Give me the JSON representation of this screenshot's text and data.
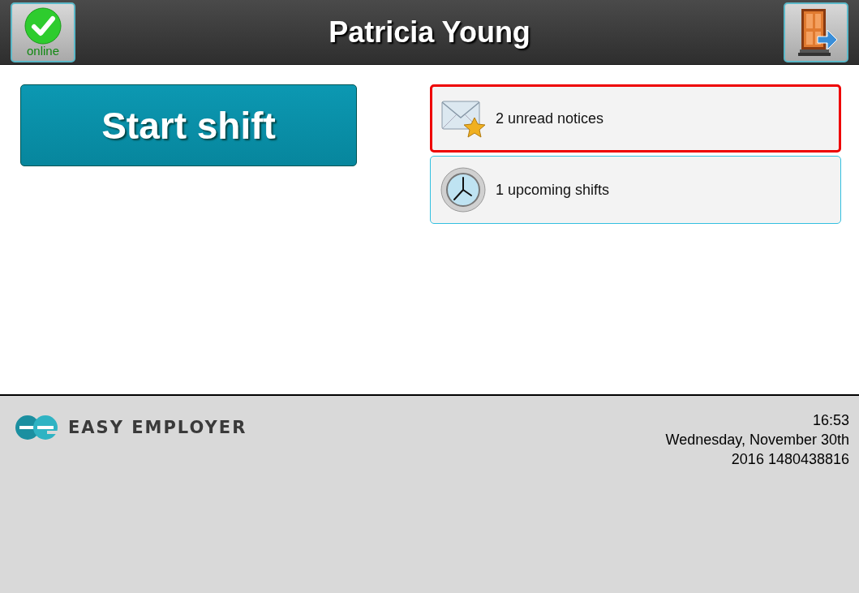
{
  "header": {
    "status": {
      "label": "online",
      "online": true
    },
    "title": "Patricia Young"
  },
  "start_button": {
    "label": "Start shift"
  },
  "notices": [
    {
      "kind": "mail",
      "label": "2 unread notices",
      "selected": true
    },
    {
      "kind": "clock",
      "label": "1 upcoming shifts",
      "selected": false
    }
  ],
  "footer": {
    "brand": "EASY EMPLOYER",
    "time": "16:53",
    "date": "Wednesday, November 30th",
    "extra": "2016 1480438816"
  }
}
